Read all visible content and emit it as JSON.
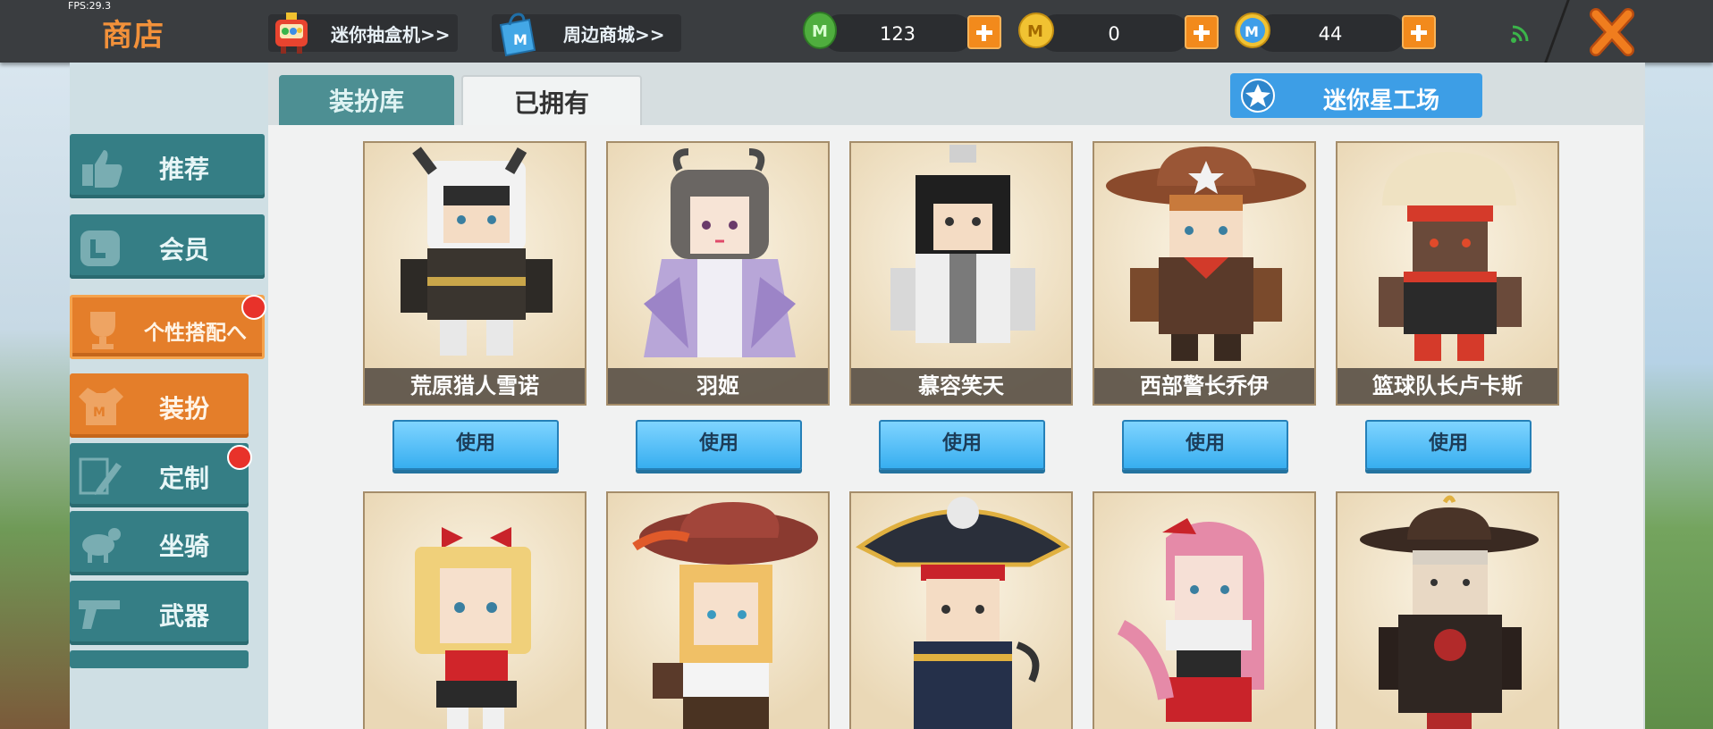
{
  "fps": "FPS:29.3",
  "header": {
    "title": "商店",
    "gacha_label": "迷你抽盒机>>",
    "mall_label": "周边商城>>",
    "currencies": [
      {
        "icon": "green-mini-coin-icon",
        "value": "123"
      },
      {
        "icon": "gold-mini-coin-icon",
        "value": "0"
      },
      {
        "icon": "blue-mini-coin-icon",
        "value": "44"
      }
    ]
  },
  "tabs": {
    "library": "装扮库",
    "owned": "已拥有"
  },
  "workshop_label": "迷你星工场",
  "sidebar": {
    "items": [
      {
        "label": "推荐"
      },
      {
        "label": "会员"
      },
      {
        "label": "个性搭配へ"
      },
      {
        "label": "装扮"
      },
      {
        "label": "定制"
      },
      {
        "label": "坐骑"
      },
      {
        "label": "武器"
      }
    ]
  },
  "skins_row1": [
    {
      "name": "荒原猎人雪诺",
      "action": "使用"
    },
    {
      "name": "羽姬",
      "action": "使用"
    },
    {
      "name": "慕容笑天",
      "action": "使用"
    },
    {
      "name": "西部警长乔伊",
      "action": "使用"
    },
    {
      "name": "篮球队长卢卡斯",
      "action": "使用"
    }
  ],
  "colors": {
    "accent_orange": "#f28a1c",
    "teal": "#357e85",
    "use_blue": "#37aef0"
  }
}
